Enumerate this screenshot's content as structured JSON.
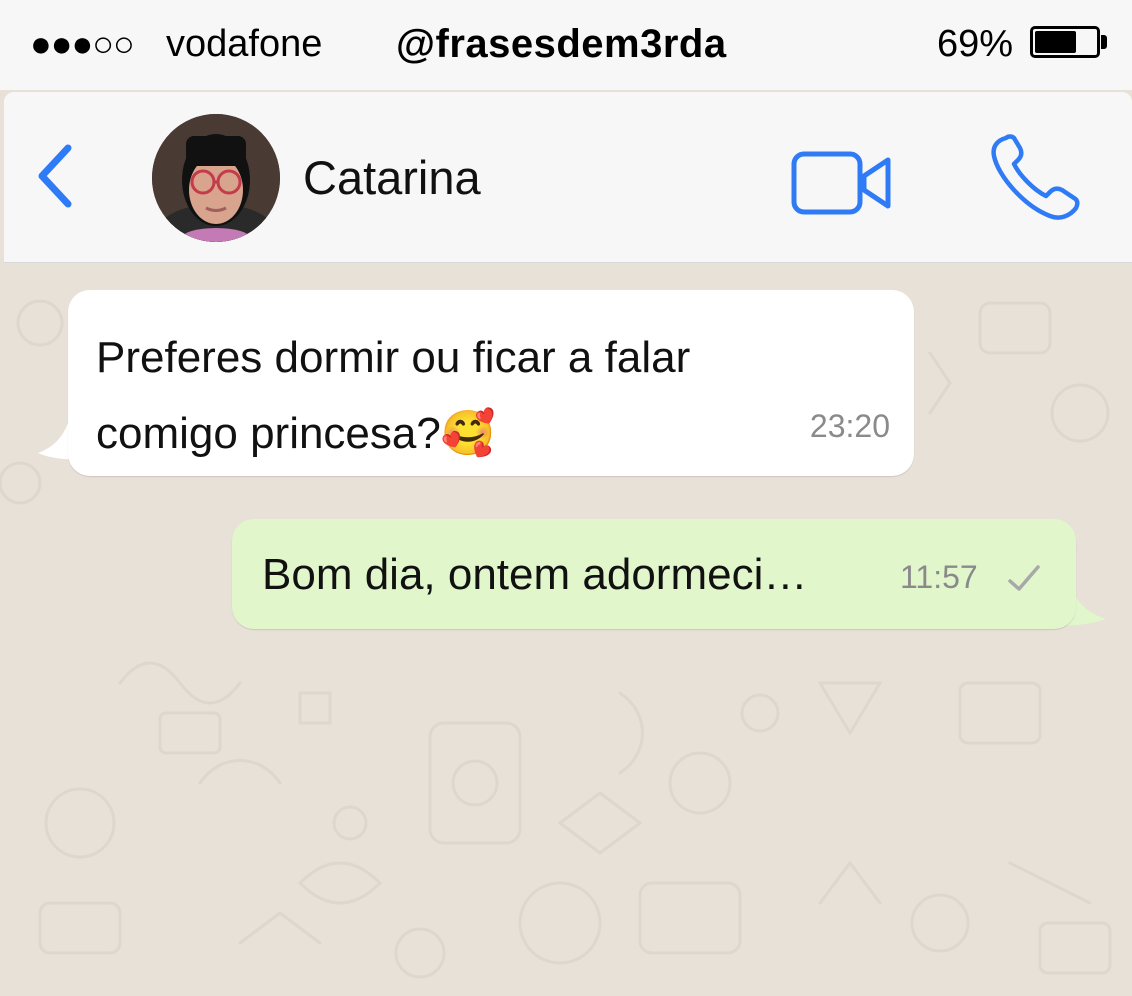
{
  "status_bar": {
    "signal": "●●●○○",
    "carrier": "vodafone",
    "watermark": "@frasesdem3rda",
    "battery_percent_label": "69%",
    "battery_level": 0.69
  },
  "header": {
    "back_icon": "chevron-left-icon",
    "contact_name": "Catarina",
    "video_icon": "video-camera-icon",
    "voice_icon": "phone-icon",
    "accent_color": "#2f7bf5"
  },
  "messages": [
    {
      "direction": "incoming",
      "text": "Preferes dormir ou ficar a falar comigo princesa?🥰",
      "time": "23:20"
    },
    {
      "direction": "outgoing",
      "text": "Bom dia, ontem adormeci…",
      "time": "11:57",
      "status_icon": "single-check-icon"
    }
  ],
  "colors": {
    "incoming_bubble": "#ffffff",
    "outgoing_bubble": "#e1f7cb",
    "chat_background": "#e7e1d8",
    "timestamp": "#8a8a8a"
  }
}
